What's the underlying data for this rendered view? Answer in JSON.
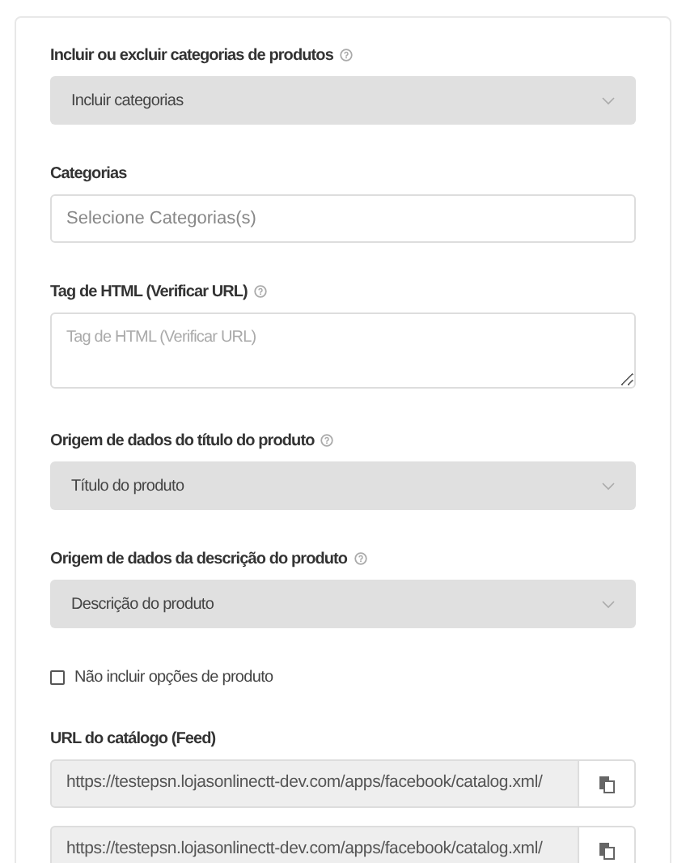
{
  "fields": [
    {
      "kind": "select",
      "label": "Incluir ou excluir categorias de produtos",
      "help": true,
      "value": "Incluir categorias"
    },
    {
      "kind": "input",
      "label": "Categorias",
      "help": false,
      "placeholder": "Selecione Categorias(s)"
    },
    {
      "kind": "textarea",
      "label": "Tag de HTML (Verificar URL)",
      "help": true,
      "placeholder": "Tag de HTML (Verificar URL)"
    },
    {
      "kind": "select",
      "label": "Origem de dados do título do produto",
      "help": true,
      "value": "Título do produto"
    },
    {
      "kind": "select",
      "label": "Origem de dados da descrição do produto",
      "help": true,
      "value": "Descrição do produto"
    },
    {
      "kind": "checkbox",
      "label": "Não incluir opções de produto",
      "checked": false
    },
    {
      "kind": "urls",
      "label": "URL do catálogo (Feed)",
      "values": [
        "https://testepsn.lojasonlinectt-dev.com/apps/facebook/catalog.xml/",
        "https://testepsn.lojasonlinectt-dev.com/apps/facebook/catalog.xml/"
      ]
    }
  ]
}
